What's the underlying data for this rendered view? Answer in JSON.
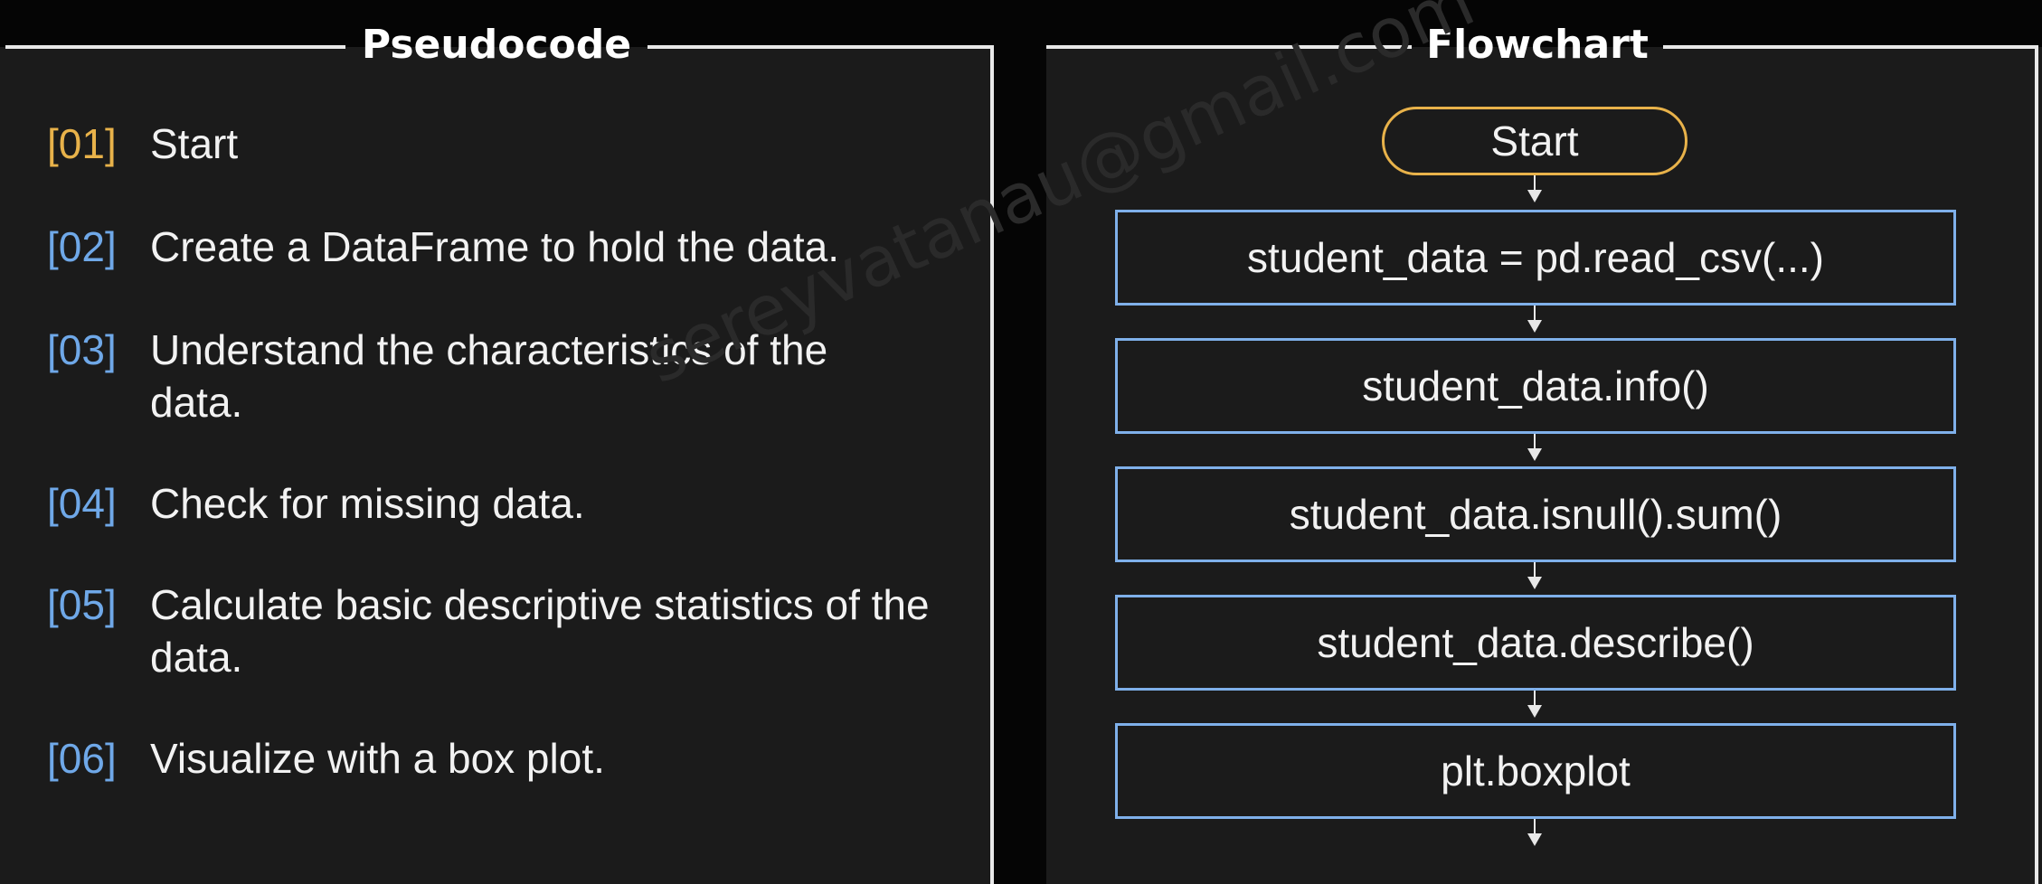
{
  "pseudocode": {
    "title": "Pseudocode",
    "steps": [
      {
        "num": "[01]",
        "text": "Start"
      },
      {
        "num": "[02]",
        "text": "Create a DataFrame to hold the data."
      },
      {
        "num": "[03]",
        "text": "Understand the characteristics of the data."
      },
      {
        "num": "[04]",
        "text": "Check for missing data."
      },
      {
        "num": "[05]",
        "text": "Calculate basic descriptive statistics of the data."
      },
      {
        "num": "[06]",
        "text": "Visualize with a box plot."
      }
    ]
  },
  "flowchart": {
    "title": "Flowchart",
    "start": "Start",
    "boxes": [
      "student_data = pd.read_csv(...)",
      "student_data.info()",
      "student_data.isnull().sum()",
      "student_data.describe()",
      "plt.boxplot"
    ]
  },
  "watermark": "sereyvatanau@gmail.com",
  "colors": {
    "accent_orange": "#e8b24a",
    "accent_blue": "#7fb0ea",
    "background": "#1b1b1b"
  }
}
